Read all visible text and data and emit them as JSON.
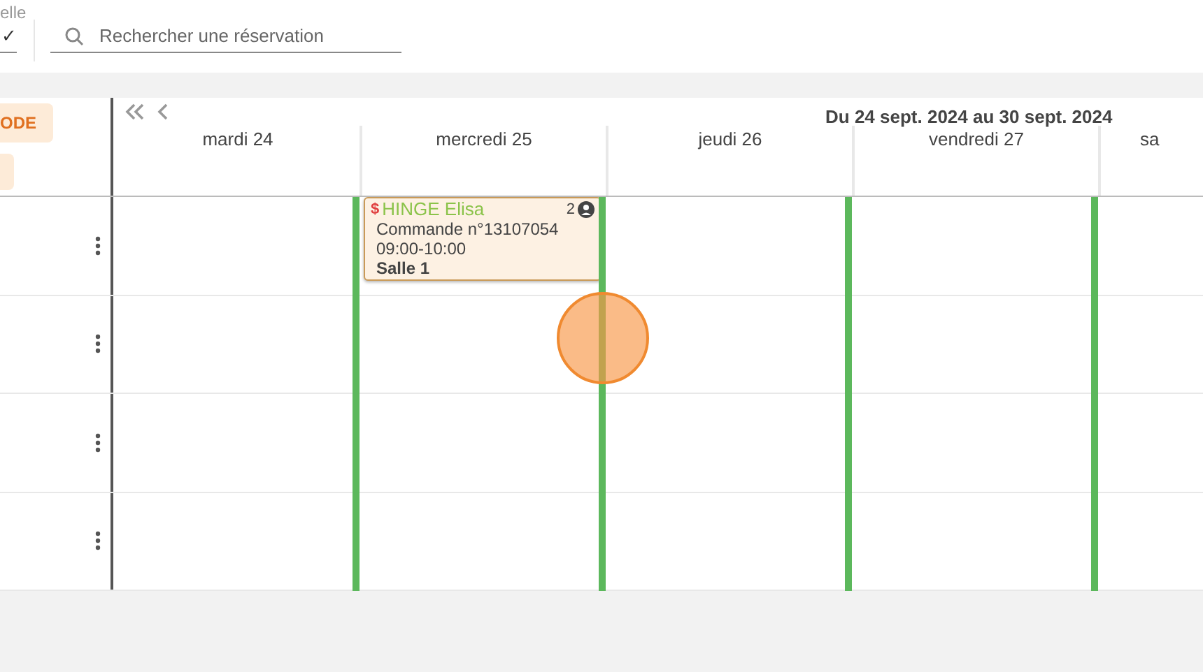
{
  "filter": {
    "label": "elle",
    "value": "✓"
  },
  "search": {
    "placeholder": "Rechercher une réservation"
  },
  "side_buttons": [
    {
      "label": "ODE"
    }
  ],
  "range_title": "Du 24 sept. 2024 au 30 sept. 2024",
  "days": [
    {
      "label": "mardi 24",
      "open": false
    },
    {
      "label": "mercredi 25",
      "open": true,
      "bookings": [
        {
          "price_mark": "$",
          "name": "HINGE Elisa",
          "count": "2",
          "order": "Commande n°13107054",
          "time": "09:00-10:00",
          "room": "Salle 1"
        }
      ]
    },
    {
      "label": "jeudi 26",
      "open": true
    },
    {
      "label": "vendredi 27",
      "open": true
    },
    {
      "label": "sa",
      "open": true
    }
  ]
}
